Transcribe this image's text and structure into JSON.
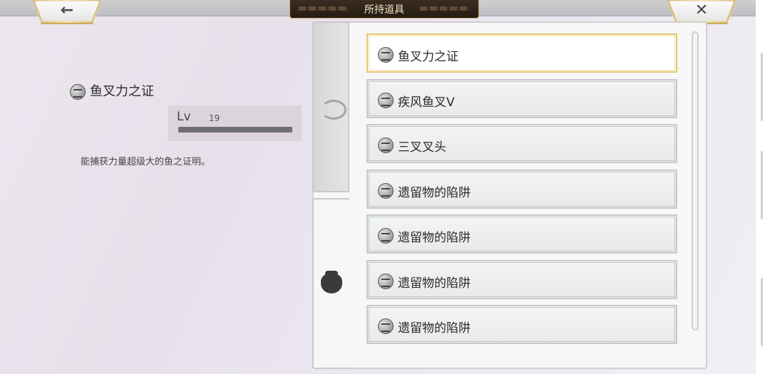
{
  "header": {
    "title": "所持道具",
    "back_icon": "←",
    "close_icon": "✕"
  },
  "detail": {
    "item_name": "鱼叉力之证",
    "lv_label": "Lv",
    "lv_value": "19",
    "progress": 1.0,
    "description": "能捕获力量超级大的鱼之证明。"
  },
  "tabs": [
    {
      "icon": "shrimp-icon",
      "active": false
    },
    {
      "icon": "pot-icon",
      "active": true
    }
  ],
  "items": [
    {
      "label": "鱼叉力之证",
      "icon": "harpoon-badge-icon",
      "selected": true
    },
    {
      "label": "疾风鱼叉Ⅴ",
      "icon": "spear-icon",
      "selected": false
    },
    {
      "label": "三叉叉头",
      "icon": "trident-icon",
      "selected": false
    },
    {
      "label": "遗留物的陷阱",
      "icon": "trap-icon",
      "selected": false
    },
    {
      "label": "遗留物的陷阱",
      "icon": "trap-icon",
      "selected": false
    },
    {
      "label": "遗留物的陷阱",
      "icon": "trap-icon",
      "selected": false
    },
    {
      "label": "遗留物的陷阱",
      "icon": "trap-icon",
      "selected": false
    }
  ]
}
